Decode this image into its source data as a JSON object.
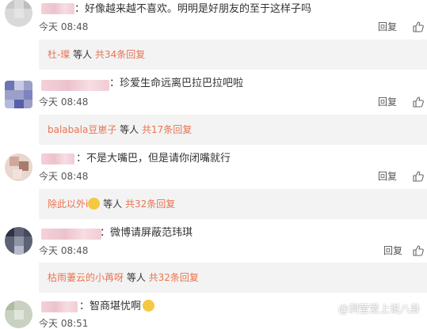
{
  "comments": [
    {
      "text": "：好像越来越不喜欢。明明是好朋友的至于这样子吗",
      "time": "今天 08:48",
      "reply": "回复",
      "sub": {
        "names": "杜-璨",
        "mid": " 等人 ",
        "count": "共34条回复"
      }
    },
    {
      "text": "：珍爱生命远离巴拉巴拉吧啦",
      "time": "今天 08:48",
      "reply": "回复",
      "sub": {
        "names": "balabala豆崽子",
        "mid": " 等人 ",
        "count": "共17条回复"
      }
    },
    {
      "text": "：不是大嘴巴，但是请你闭嘴就行",
      "time": "今天 08:48",
      "reply": "回复",
      "sub": {
        "names": "除此以外i",
        "mid": " 等人 ",
        "count": "共32条回复"
      }
    },
    {
      "text": "：微博请屏蔽范玮琪",
      "time": "今天 08:48",
      "reply": "回复",
      "sub": {
        "names": "枯雨萋云的小苒呀",
        "mid": " 等人 ",
        "count": "共32条回复"
      }
    },
    {
      "text": "：智商堪忧啊",
      "time": "今天 08:51"
    }
  ],
  "watermark": "@洞莹爱上说八卦",
  "colors": {
    "link": "#eb7350",
    "sub_bg": "#f3f3f3"
  }
}
